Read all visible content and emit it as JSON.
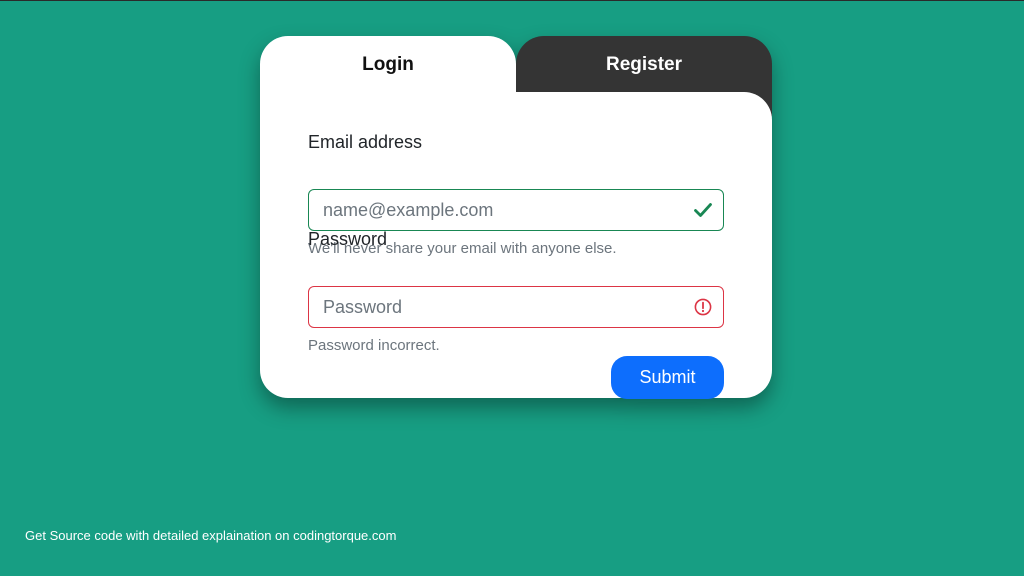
{
  "tabs": {
    "login_label": "Login",
    "register_label": "Register"
  },
  "form": {
    "email_label": "Email address",
    "email_placeholder": "name@example.com",
    "email_value": "",
    "email_help": "We'll never share your email with anyone else.",
    "email_status_icon": "check-icon",
    "password_label": "Password",
    "password_placeholder": "Password",
    "password_value": "",
    "password_help": "Password incorrect.",
    "password_status_icon": "exclamation-circle-icon",
    "submit_label": "Submit"
  },
  "footer": {
    "text": "Get Source code with detailed explaination on codingtorque.com"
  },
  "colors": {
    "background": "#179e83",
    "active_tab": "#ffffff",
    "inactive_tab": "#343434",
    "valid": "#198754",
    "invalid": "#dc3545",
    "primary": "#0d6efd"
  }
}
